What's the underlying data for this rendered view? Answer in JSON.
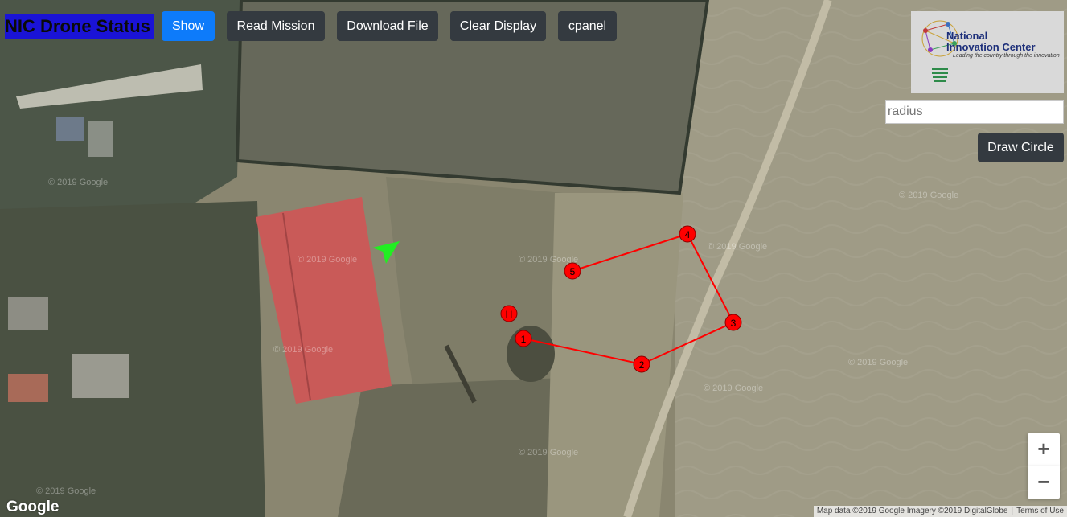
{
  "header": {
    "title": "NIC Drone Status",
    "buttons": {
      "show": "Show",
      "read_mission": "Read Mission",
      "download_file": "Download File",
      "clear_display": "Clear Display",
      "cpanel": "cpanel"
    }
  },
  "logo": {
    "line1": "National",
    "line2": "Innovation Center",
    "tagline": "Leading the country through the innovation"
  },
  "circle_tool": {
    "radius_placeholder": "radius",
    "draw_label": "Draw Circle"
  },
  "map": {
    "zoom_in": "+",
    "zoom_out": "−",
    "google_label": "Google",
    "attribution": "Map data ©2019 Google Imagery ©2019 DigitalGlobe",
    "terms": "Terms of Use",
    "watermark": "© 2019 Google",
    "waypoint_labels": [
      "H",
      "1",
      "2",
      "3",
      "4",
      "5"
    ],
    "colors": {
      "waypoint": "#ff0000",
      "drone": "#22ee22",
      "route": "#ff0000"
    }
  }
}
